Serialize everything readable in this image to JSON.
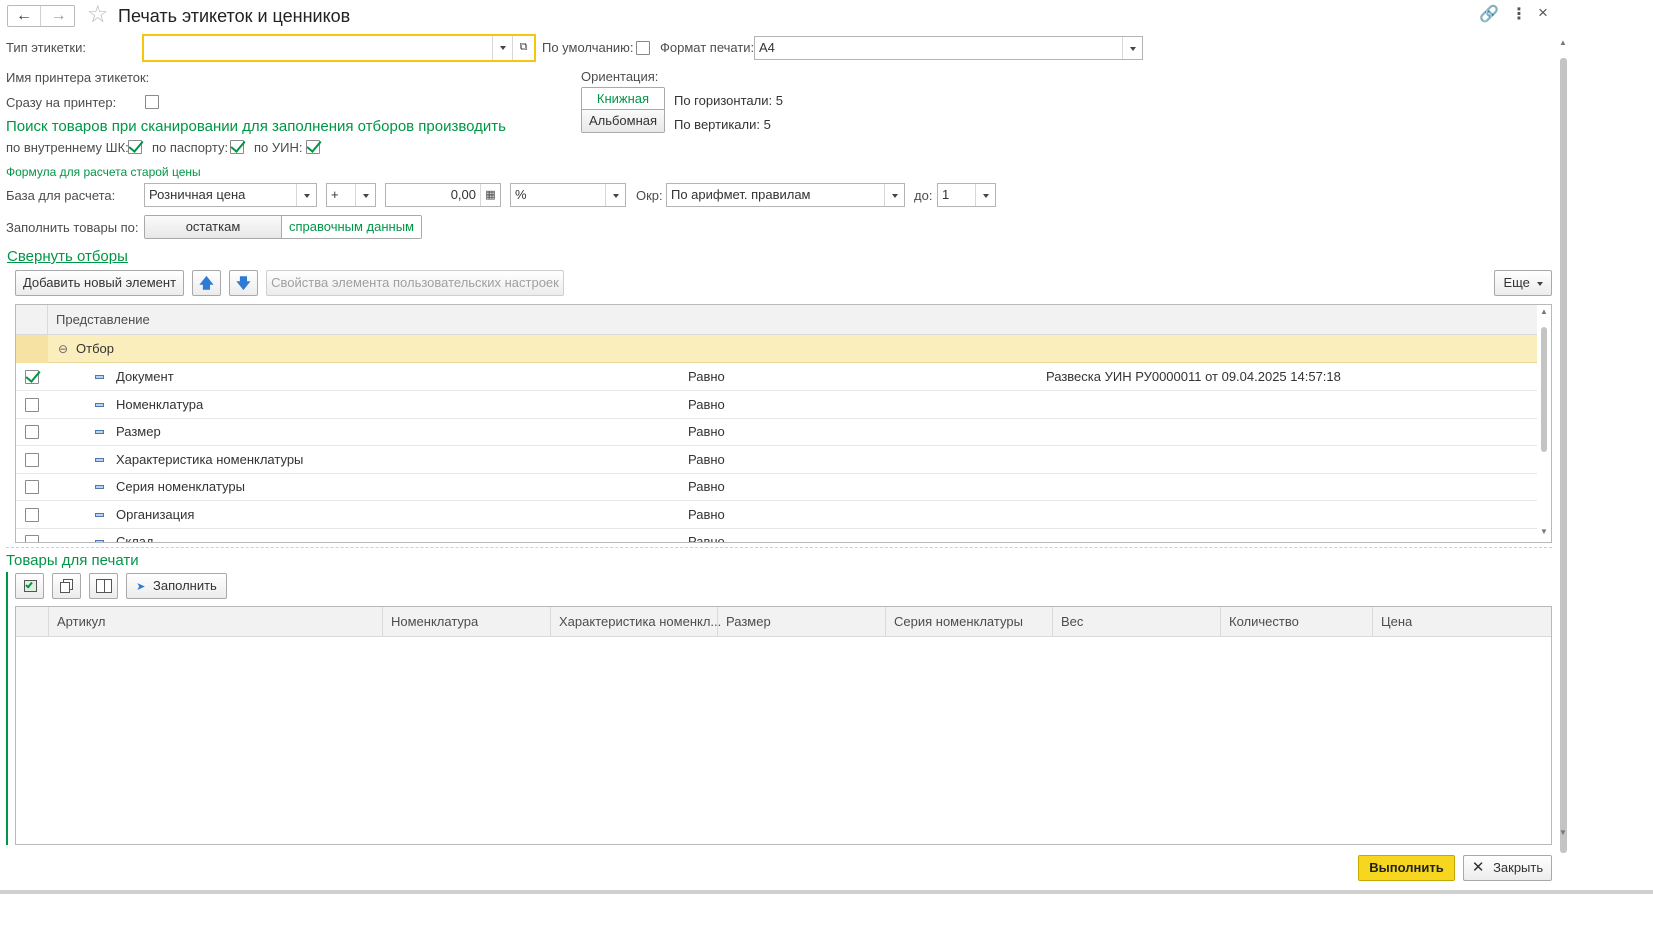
{
  "window": {
    "title": "Печать этикеток и ценников"
  },
  "header": {
    "label_type": "Тип этикетки:",
    "label_type_value": "",
    "default_label": "По умолчанию:",
    "print_format_label": "Формат печати:",
    "print_format_value": "А4",
    "printer_name_label": "Имя принтера этикеток:",
    "direct_print_label": "Сразу на принтер:",
    "orientation_label": "Ориентация:",
    "orientation_portrait": "Книжная",
    "orientation_landscape": "Альбомная",
    "horizontal_label": "По горизонтали: 5",
    "vertical_label": "По вертикали: 5"
  },
  "search": {
    "title": "Поиск товаров при сканировании для заполнения отборов производить",
    "by_barcode": "по внутреннему ШК:",
    "by_passport": "по паспорту:",
    "by_uin": "по УИН:"
  },
  "formula": {
    "title": "Формула для расчета старой цены",
    "base_label": "База для расчета:",
    "base_value": "Розничная цена",
    "operator": "+",
    "amount": "0,00",
    "unit": "%",
    "round_label": "Окр:",
    "round_value": "По арифмет. правилам",
    "to_label": "до:",
    "to_value": "1"
  },
  "fill": {
    "label": "Заполнить товары по:",
    "option_stock": "остаткам",
    "option_reference": "справочным данным"
  },
  "filters": {
    "collapse_link": "Свернуть отборы",
    "add_button": "Добавить новый элемент",
    "properties_button": "Свойства элемента пользовательских настроек",
    "more_button": "Еще",
    "column_title": "Представление",
    "group_label": "Отбор",
    "rows": [
      {
        "name": "Документ",
        "cond": "Равно",
        "value": "Развеска УИН РУ0000011 от 09.04.2025 14:57:18",
        "checked": true
      },
      {
        "name": "Номенклатура",
        "cond": "Равно",
        "value": "",
        "checked": false
      },
      {
        "name": "Размер",
        "cond": "Равно",
        "value": "",
        "checked": false
      },
      {
        "name": "Характеристика номенклатуры",
        "cond": "Равно",
        "value": "",
        "checked": false
      },
      {
        "name": "Серия номенклатуры",
        "cond": "Равно",
        "value": "",
        "checked": false
      },
      {
        "name": "Организация",
        "cond": "Равно",
        "value": "",
        "checked": false
      },
      {
        "name": "Склад",
        "cond": "Равно",
        "value": "",
        "checked": false
      }
    ]
  },
  "goods": {
    "title": "Товары для печати",
    "fill_button": "Заполнить",
    "columns": [
      "Артикул",
      "Номенклатура",
      "Характеристика номенкл...",
      "Размер",
      "Серия номенклатуры",
      "Вес",
      "Количество",
      "Цена"
    ]
  },
  "footer": {
    "execute": "Выполнить",
    "close": "Закрыть"
  }
}
